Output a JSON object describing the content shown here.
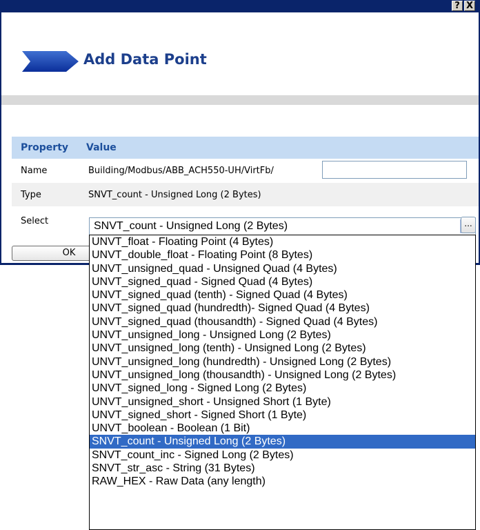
{
  "window": {
    "help_label": "?",
    "close_label": "X"
  },
  "page": {
    "title": "Add Data Point"
  },
  "table": {
    "property_header": "Property",
    "value_header": "Value",
    "rows": {
      "name": {
        "label": "Name",
        "value": "Building/Modbus/ABB_ACH550-UH/VirtFb/"
      },
      "type": {
        "label": "Type",
        "value": "SNVT_count - Unsigned Long (2 Bytes)"
      },
      "select": {
        "label": "Select",
        "value": "SNVT_count - Unsigned Long (2 Bytes)"
      }
    }
  },
  "buttons": {
    "browse_label": "...",
    "ok_label": "OK"
  },
  "dropdown": {
    "selected_index": 15,
    "options": [
      "UNVT_float - Floating Point (4 Bytes)",
      "UNVT_double_float - Floating Point (8 Bytes)",
      "UNVT_unsigned_quad - Unsigned Quad (4 Bytes)",
      "UNVT_signed_quad - Signed Quad (4 Bytes)",
      "UNVT_signed_quad (tenth) - Signed Quad (4 Bytes)",
      "UNVT_signed_quad (hundredth)- Signed Quad (4 Bytes)",
      "UNVT_signed_quad (thousandth) - Signed Quad (4 Bytes)",
      "UNVT_unsigned_long - Unsigned Long (2 Bytes)",
      "UNVT_unsigned_long (tenth) - Unsigned Long (2 Bytes)",
      "UNVT_unsigned_long (hundredth) - Unsigned Long (2 Bytes)",
      "UNVT_unsigned_long (thousandth) - Unsigned Long (2 Bytes)",
      "UNVT_signed_long - Signed Long (2 Bytes)",
      "UNVT_unsigned_short - Unsigned Short (1 Byte)",
      "UNVT_signed_short - Signed Short (1 Byte)",
      "UNVT_boolean - Boolean (1 Bit)",
      "SNVT_count - Unsigned Long (2 Bytes)",
      "SNVT_count_inc - Signed Long (2 Bytes)",
      "SNVT_str_asc - String (31 Bytes)",
      "RAW_HEX - Raw Data (any length)"
    ]
  },
  "colors": {
    "titlebar": "#0a246a",
    "title_text": "#1c3f8c",
    "header_band": "#c5dbf3",
    "selected_option": "#316ac5"
  },
  "icons": {
    "logo": "chevron-arrow-icon",
    "dropdown_toggle": "chevron-down-icon"
  }
}
